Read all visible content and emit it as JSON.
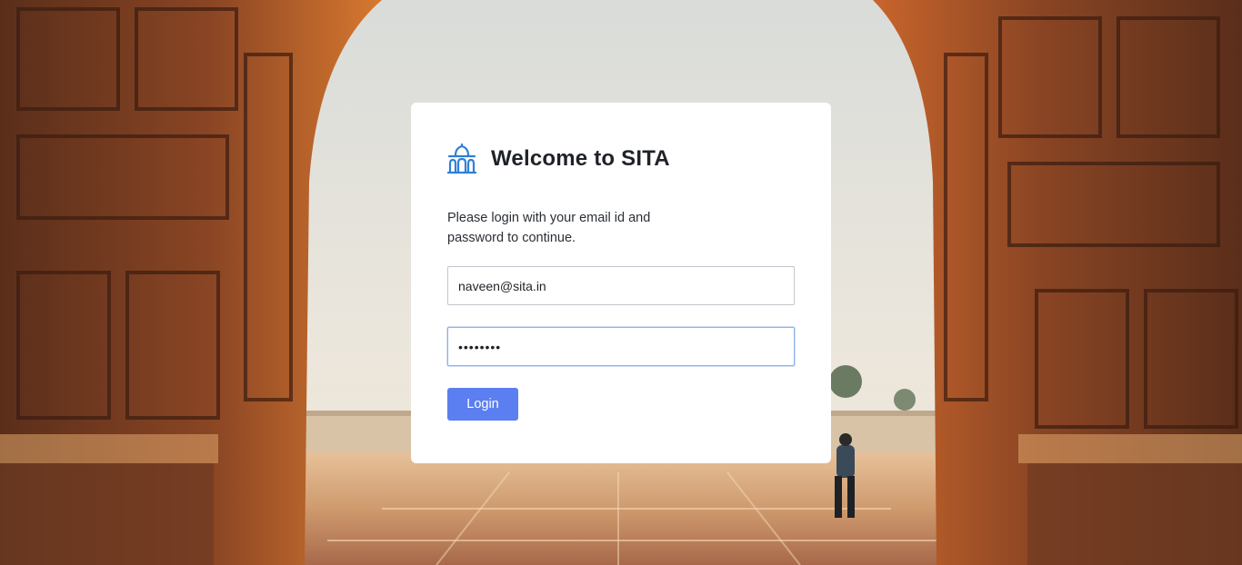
{
  "login": {
    "title": "Welcome to SITA",
    "subtitle": "Please login with your email id and password to continue.",
    "email_value": "naveen@sita.in",
    "password_value": "••••••••",
    "login_label": "Login"
  },
  "colors": {
    "accent": "#5b7ff0",
    "logo": "#2f7fd8",
    "card": "#ffffff",
    "title": "#1f2328"
  },
  "icons": {
    "brand": "monument-icon"
  }
}
